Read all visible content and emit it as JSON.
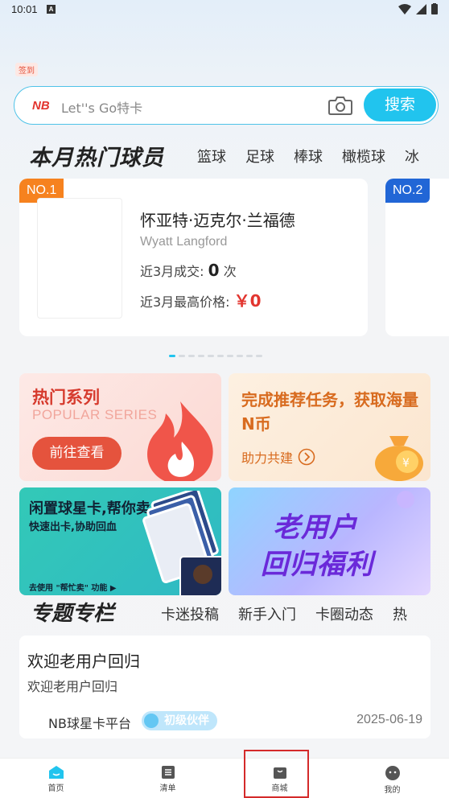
{
  "status_bar": {
    "time": "10:01",
    "indicator": "A"
  },
  "signin_badge": "签到",
  "search": {
    "logo_main": "NB",
    "placeholder": "Let''s Go特卡",
    "button": "搜索"
  },
  "hot_players": {
    "title": "本月热门球员",
    "tabs": [
      "篮球",
      "足球",
      "棒球",
      "橄榄球",
      "冰"
    ],
    "cards": [
      {
        "rank": "NO.1",
        "name_cn": "怀亚特·迈克尔·兰福德",
        "name_en": "Wyatt Langford",
        "deals_label": "近3月成交:",
        "deals_value": "0",
        "deals_unit": "次",
        "price_label": "近3月最高价格:",
        "price_value": "￥0"
      },
      {
        "rank": "NO.2"
      }
    ]
  },
  "promos": {
    "popular": {
      "title": "热门系列",
      "subtitle": "POPULAR SERIES",
      "button": "前往查看"
    },
    "task": {
      "title": "完成推荐任务，获取海量N币",
      "link": "助力共建"
    },
    "idle": {
      "title": "闲置球星卡,帮你卖",
      "subtitle": "快速出卡,协助回血",
      "note": "去使用 \"帮忙卖\" 功能 ▶"
    },
    "return": {
      "line1": "老用户",
      "line2": "回归福利"
    }
  },
  "topics": {
    "title": "专题专栏",
    "tabs": [
      "卡迷投稿",
      "新手入门",
      "卡圈动态",
      "热"
    ],
    "article": {
      "title": "欢迎老用户回归",
      "summary": "欢迎老用户回归",
      "author": "NB球星卡平台",
      "badge": "初级伙伴",
      "date": "2025-06-19"
    }
  },
  "bottom_nav": [
    {
      "label": "首页",
      "icon": "home-icon"
    },
    {
      "label": "清单",
      "icon": "list-icon"
    },
    {
      "label": "商城",
      "icon": "shop-bag-icon"
    },
    {
      "label": "我的",
      "icon": "profile-icon"
    }
  ],
  "colors": {
    "accent": "#21c4ee",
    "red": "#e2352f",
    "orange_rank": "#f6821f",
    "blue_rank": "#2166d6"
  }
}
